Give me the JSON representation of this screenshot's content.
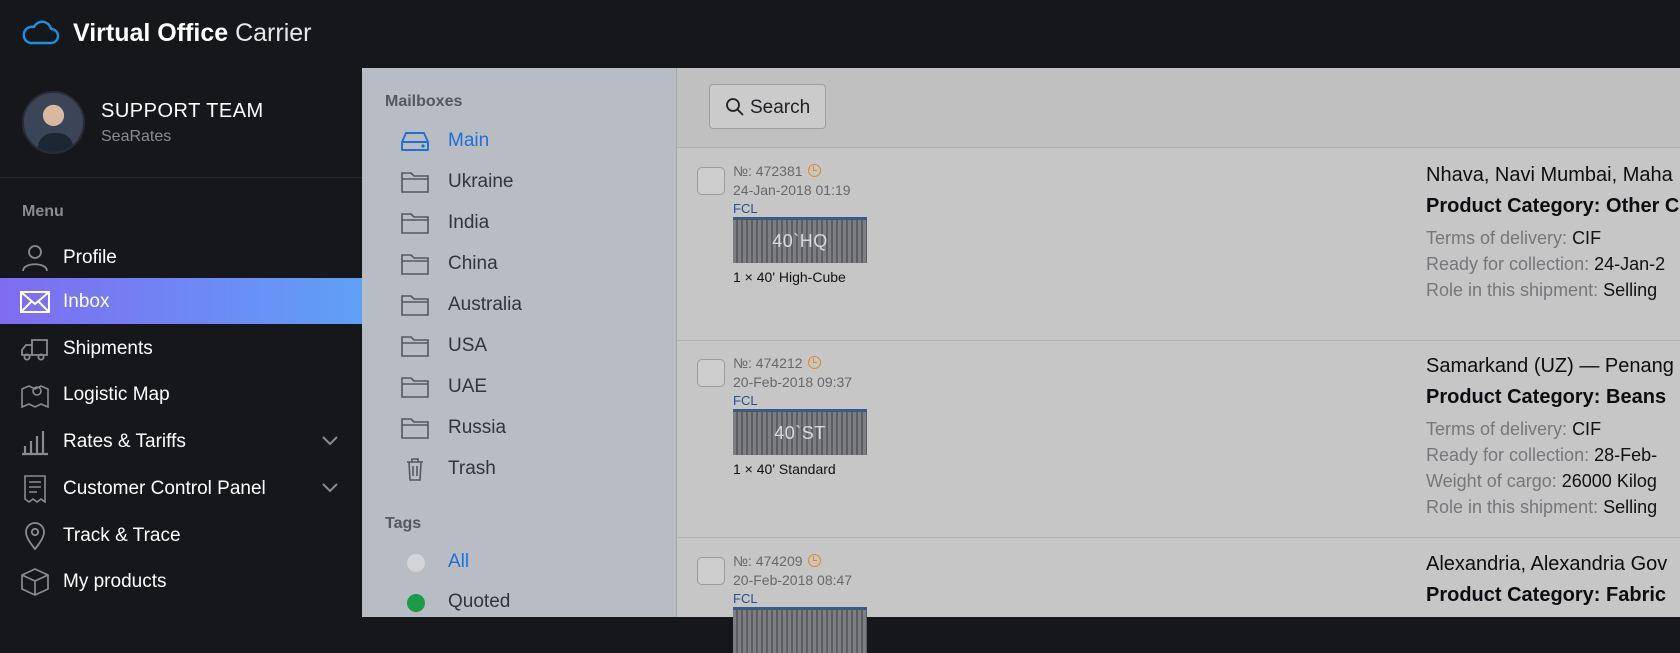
{
  "app": {
    "title_bold": "Virtual Office",
    "title_light": "Carrier",
    "logo_icon": "cloud-icon",
    "brand_color": "#1f8fe0"
  },
  "user": {
    "name": "SUPPORT TEAM",
    "org": "SeaRates"
  },
  "menu": {
    "title": "Menu",
    "items": [
      {
        "label": "Profile",
        "icon": "user-icon"
      },
      {
        "label": "Inbox",
        "icon": "mail-icon",
        "active": true
      },
      {
        "label": "Shipments",
        "icon": "truck-icon"
      },
      {
        "label": "Logistic Map",
        "icon": "map-pin-icon"
      },
      {
        "label": "Rates & Tariffs",
        "icon": "bar-chart-icon",
        "expandable": true
      },
      {
        "label": "Customer Control Panel",
        "icon": "receipt-icon",
        "expandable": true
      },
      {
        "label": "Track & Trace",
        "icon": "location-icon"
      },
      {
        "label": "My products",
        "icon": "box-icon"
      }
    ],
    "active_gradient": [
      "#7f6cf0",
      "#5fa0f7"
    ]
  },
  "mailboxes": {
    "title": "Mailboxes",
    "items": [
      {
        "label": "Main",
        "icon": "inbox-drive-icon",
        "active": true
      },
      {
        "label": "Ukraine",
        "icon": "folder-icon"
      },
      {
        "label": "India",
        "icon": "folder-icon"
      },
      {
        "label": "China",
        "icon": "folder-icon"
      },
      {
        "label": "Australia",
        "icon": "folder-icon"
      },
      {
        "label": "USA",
        "icon": "folder-icon"
      },
      {
        "label": "UAE",
        "icon": "folder-icon"
      },
      {
        "label": "Russia",
        "icon": "folder-icon"
      },
      {
        "label": "Trash",
        "icon": "trash-icon"
      }
    ]
  },
  "tags": {
    "title": "Tags",
    "items": [
      {
        "label": "All",
        "color": "#d3d5d9",
        "active": true
      },
      {
        "label": "Quoted",
        "color": "#1c9b4a"
      }
    ]
  },
  "toolbar": {
    "search_label": "Search"
  },
  "requests": [
    {
      "number": "№: 472381",
      "date": "24-Jan-2018 01:19",
      "mode": "FCL",
      "container_code": "40`HQ",
      "quantity": "1 × 40' High-Cube",
      "route": "Nhava, Navi Mumbai, Maha",
      "category_label": "Product Category:",
      "category": "Other C",
      "details": [
        {
          "label": "Terms of delivery:",
          "value": "CIF"
        },
        {
          "label": "Ready for collection:",
          "value": "24-Jan-2"
        },
        {
          "label": "Role in this shipment:",
          "value": "Selling"
        }
      ]
    },
    {
      "number": "№: 474212",
      "date": "20-Feb-2018 09:37",
      "mode": "FCL",
      "container_code": "40`ST",
      "quantity": "1 × 40' Standard",
      "route": "Samarkand (UZ) — Penang",
      "category_label": "Product Category:",
      "category": "Beans",
      "details": [
        {
          "label": "Terms of delivery:",
          "value": "CIF"
        },
        {
          "label": "Ready for collection:",
          "value": "28-Feb-"
        },
        {
          "label": "Weight of cargo:",
          "value": "26000 Kilog"
        },
        {
          "label": "Role in this shipment:",
          "value": "Selling"
        }
      ]
    },
    {
      "number": "№: 474209",
      "date": "20-Feb-2018 08:47",
      "mode": "FCL",
      "container_code": "",
      "quantity": "",
      "route": "Alexandria, Alexandria Gov",
      "category_label": "Product Category:",
      "category": "Fabric",
      "details": []
    }
  ]
}
